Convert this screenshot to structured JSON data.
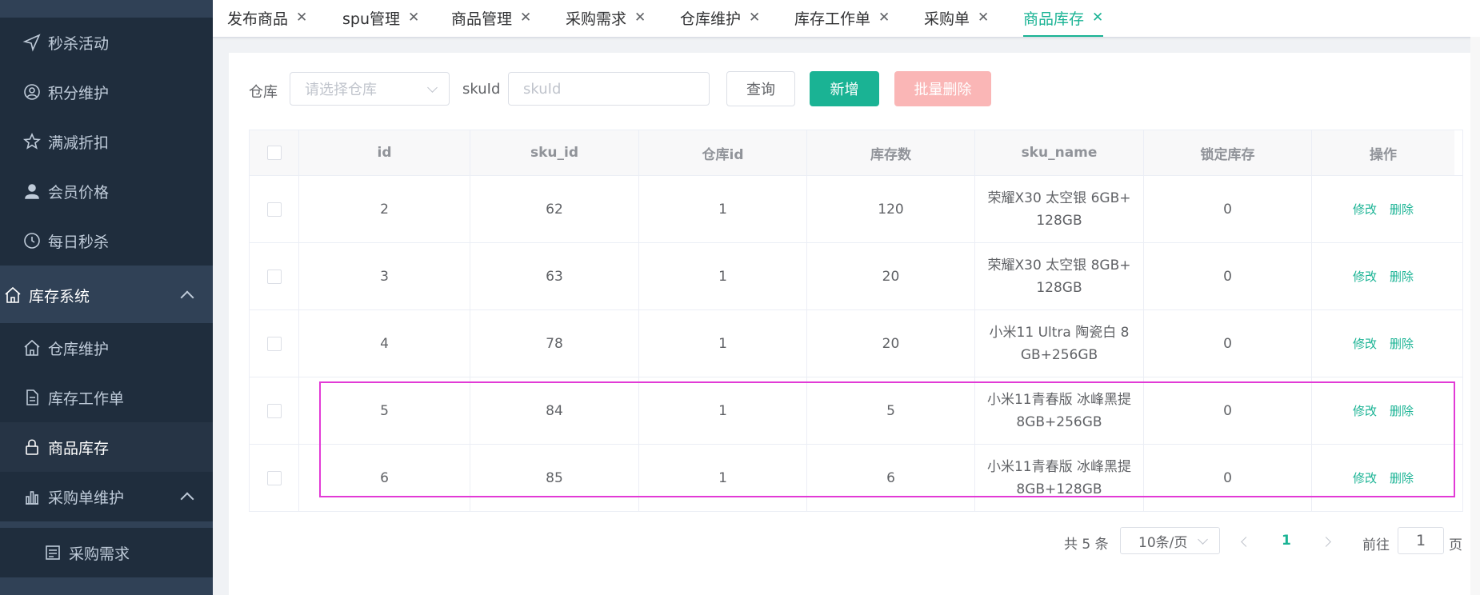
{
  "sidebar": {
    "items": [
      {
        "label": "秒杀活动",
        "icon": "send-icon"
      },
      {
        "label": "积分维护",
        "icon": "user-circle-icon"
      },
      {
        "label": "满减折扣",
        "icon": "star-icon"
      },
      {
        "label": "会员价格",
        "icon": "person-icon"
      },
      {
        "label": "每日秒杀",
        "icon": "clock-icon"
      },
      {
        "label": "库存系统",
        "icon": "home-icon"
      },
      {
        "label": "仓库维护",
        "icon": "home-icon"
      },
      {
        "label": "库存工作单",
        "icon": "document-icon"
      },
      {
        "label": "商品库存",
        "icon": "lock-icon"
      },
      {
        "label": "采购单维护",
        "icon": "bar-chart-icon"
      },
      {
        "label": "采购需求",
        "icon": "list-icon"
      }
    ]
  },
  "tabs": [
    {
      "label": "发布商品"
    },
    {
      "label": "spu管理"
    },
    {
      "label": "商品管理"
    },
    {
      "label": "采购需求"
    },
    {
      "label": "仓库维护"
    },
    {
      "label": "库存工作单"
    },
    {
      "label": "采购单"
    },
    {
      "label": "商品库存"
    }
  ],
  "filters": {
    "warehouse_label": "仓库",
    "warehouse_placeholder": "请选择仓库",
    "skuid_label": "skuId",
    "skuid_placeholder": "skuId"
  },
  "buttons": {
    "query": "查询",
    "add": "新增",
    "batch_delete": "批量删除"
  },
  "table": {
    "headers": [
      "id",
      "sku_id",
      "仓库id",
      "库存数",
      "sku_name",
      "锁定库存",
      "操作"
    ],
    "rows": [
      {
        "id": "2",
        "sku_id": "62",
        "ware_id": "1",
        "stock": "120",
        "sku_name": "荣耀X30 太空银 6GB+128GB",
        "locked": "0"
      },
      {
        "id": "3",
        "sku_id": "63",
        "ware_id": "1",
        "stock": "20",
        "sku_name": "荣耀X30 太空银 8GB+128GB",
        "locked": "0"
      },
      {
        "id": "4",
        "sku_id": "78",
        "ware_id": "1",
        "stock": "20",
        "sku_name": "小米11 Ultra 陶瓷白 8GB+256GB",
        "locked": "0"
      },
      {
        "id": "5",
        "sku_id": "84",
        "ware_id": "1",
        "stock": "5",
        "sku_name": "小米11青春版 冰峰黑提 8GB+256GB",
        "locked": "0"
      },
      {
        "id": "6",
        "sku_id": "85",
        "ware_id": "1",
        "stock": "6",
        "sku_name": "小米11青春版 冰峰黑提 8GB+128GB",
        "locked": "0"
      }
    ],
    "edit_label": "修改",
    "delete_label": "删除"
  },
  "pagination": {
    "total_text": "共 5 条",
    "page_size": "10条/页",
    "current_page": "1",
    "goto_label": "前往",
    "goto_value": "1",
    "page_suffix": "页"
  },
  "colors": {
    "accent": "#1ab394",
    "sidebar_bg": "#304156",
    "highlight": "#e23ad6",
    "danger_disabled": "#fab6b6"
  }
}
